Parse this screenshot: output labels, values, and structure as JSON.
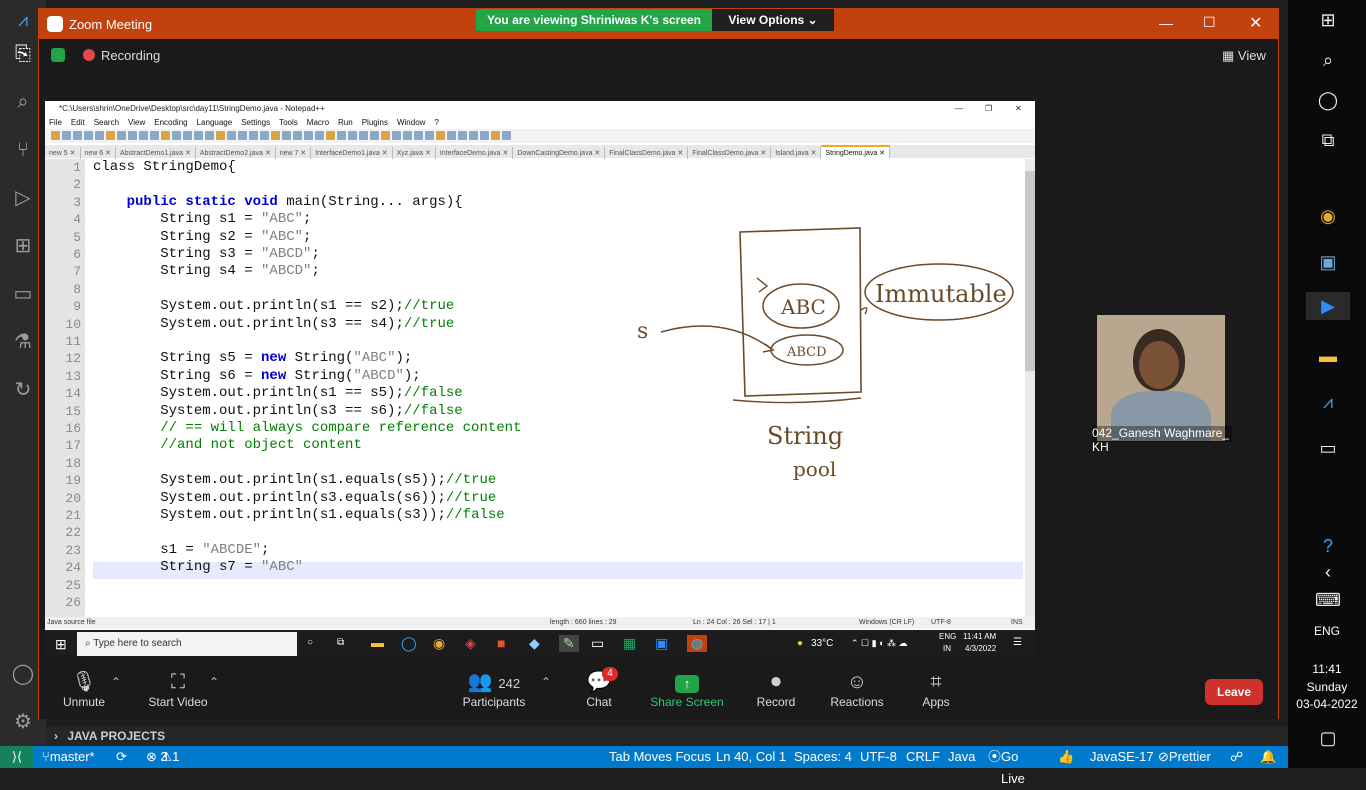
{
  "zoom": {
    "title": "Zoom Meeting",
    "banner": "You are viewing Shriniwas K's screen",
    "view_options": "View Options",
    "recording": "Recording",
    "view": "View",
    "participant_name": "042_Ganesh Waghmare_ KH",
    "participants_count": "242",
    "chat_badge": "4",
    "buttons": {
      "unmute": "Unmute",
      "video": "Start Video",
      "participants": "Participants",
      "chat": "Chat",
      "share": "Share Screen",
      "record": "Record",
      "reactions": "Reactions",
      "apps": "Apps",
      "leave": "Leave"
    }
  },
  "notepad": {
    "title": "*C:\\Users\\shrin\\OneDrive\\Desktop\\src\\day11\\StringDemo.java - Notepad++",
    "menu": [
      "File",
      "Edit",
      "Search",
      "View",
      "Encoding",
      "Language",
      "Settings",
      "Tools",
      "Macro",
      "Run",
      "Plugins",
      "Window",
      "?"
    ],
    "tabs": [
      "new 5",
      "new 6",
      "AbstractDemo1.java",
      "AbstractDemo2.java",
      "new 7",
      "InterfaceDemo1.java",
      "Xyz.java",
      "InterfaceDemo.java",
      "DownCastingDemo.java",
      "FinalClassDemo.java",
      "FinalClassDemo.java",
      "Island.java",
      "StringDemo.java"
    ],
    "code": [
      {
        "n": "1",
        "t": [
          [
            "",
            "class StringDemo{"
          ]
        ]
      },
      {
        "n": "2",
        "t": []
      },
      {
        "n": "3",
        "t": [
          [
            "",
            "    "
          ],
          [
            "kw",
            "public static void"
          ],
          [
            "",
            " main(String... args){"
          ]
        ]
      },
      {
        "n": "4",
        "t": [
          [
            "",
            "        String s1 = "
          ],
          [
            "str",
            "\"ABC\""
          ],
          [
            "",
            ";"
          ]
        ]
      },
      {
        "n": "5",
        "t": [
          [
            "",
            "        String s2 = "
          ],
          [
            "str",
            "\"ABC\""
          ],
          [
            "",
            ";"
          ]
        ]
      },
      {
        "n": "6",
        "t": [
          [
            "",
            "        String s3 = "
          ],
          [
            "str",
            "\"ABCD\""
          ],
          [
            "",
            ";"
          ]
        ]
      },
      {
        "n": "7",
        "t": [
          [
            "",
            "        String s4 = "
          ],
          [
            "str",
            "\"ABCD\""
          ],
          [
            "",
            ";"
          ]
        ]
      },
      {
        "n": "8",
        "t": []
      },
      {
        "n": "9",
        "t": [
          [
            "",
            "        System.out.println(s1 == s2);"
          ],
          [
            "cm",
            "//true"
          ]
        ]
      },
      {
        "n": "10",
        "t": [
          [
            "",
            "        System.out.println(s3 == s4);"
          ],
          [
            "cm",
            "//true"
          ]
        ]
      },
      {
        "n": "11",
        "t": []
      },
      {
        "n": "12",
        "t": [
          [
            "",
            "        String s5 = "
          ],
          [
            "kw",
            "new"
          ],
          [
            "",
            " String("
          ],
          [
            "str",
            "\"ABC\""
          ],
          [
            "",
            ");"
          ]
        ]
      },
      {
        "n": "13",
        "t": [
          [
            "",
            "        String s6 = "
          ],
          [
            "kw",
            "new"
          ],
          [
            "",
            " String("
          ],
          [
            "str",
            "\"ABCD\""
          ],
          [
            "",
            ");"
          ]
        ]
      },
      {
        "n": "14",
        "t": [
          [
            "",
            "        System.out.println(s1 == s5);"
          ],
          [
            "cm",
            "//false"
          ]
        ]
      },
      {
        "n": "15",
        "t": [
          [
            "",
            "        System.out.println(s3 == s6);"
          ],
          [
            "cm",
            "//false"
          ]
        ]
      },
      {
        "n": "16",
        "t": [
          [
            "cm",
            "        // == will always compare reference content"
          ]
        ]
      },
      {
        "n": "17",
        "t": [
          [
            "cm",
            "        //and not object content"
          ]
        ]
      },
      {
        "n": "18",
        "t": []
      },
      {
        "n": "19",
        "t": [
          [
            "",
            "        System.out.println(s1.equals(s5));"
          ],
          [
            "cm",
            "//true"
          ]
        ]
      },
      {
        "n": "20",
        "t": [
          [
            "",
            "        System.out.println(s3.equals(s6));"
          ],
          [
            "cm",
            "//true"
          ]
        ]
      },
      {
        "n": "21",
        "t": [
          [
            "",
            "        System.out.println(s1.equals(s3));"
          ],
          [
            "cm",
            "//false"
          ]
        ]
      },
      {
        "n": "22",
        "t": []
      },
      {
        "n": "23",
        "t": [
          [
            "",
            "        s1 = "
          ],
          [
            "str",
            "\"ABCDE\""
          ],
          [
            "",
            ";"
          ]
        ]
      },
      {
        "n": "24",
        "t": [
          [
            "",
            "        String s7 = "
          ],
          [
            "str",
            "\"ABC\""
          ]
        ]
      },
      {
        "n": "25",
        "t": []
      },
      {
        "n": "26",
        "t": []
      }
    ],
    "status": {
      "type": "Java source file",
      "length": "length : 660   lines : 29",
      "pos": "Ln : 24   Col : 26   Sel : 17 | 1",
      "eol": "Windows (CR LF)",
      "enc": "UTF-8",
      "ins": "INS"
    },
    "drawing": {
      "a": "ABC",
      "b": "ABCD",
      "s": "s",
      "imm": "Immutable",
      "pool1": "String",
      "pool2": "pool"
    }
  },
  "win_taskbar_inner": {
    "search": "Type here to search",
    "temp": "33°C",
    "lang": "ENG",
    "lang2": "IN",
    "time": "11:41 AM",
    "date": "4/3/2022"
  },
  "win_taskbar": {
    "lang": "ENG",
    "time": "11:41",
    "day": "Sunday",
    "date": "03-04-2022"
  },
  "vscode": {
    "java_projects": "JAVA PROJECTS",
    "branch": "master*",
    "errors": "3",
    "warnings": "1",
    "tab_focus": "Tab Moves Focus",
    "ln": "Ln 40, Col 1",
    "spaces": "Spaces: 4",
    "enc": "UTF-8",
    "eol": "CRLF",
    "lang": "Java",
    "golive": "Go Live",
    "jdk": "JavaSE-17",
    "prettier": "Prettier"
  }
}
